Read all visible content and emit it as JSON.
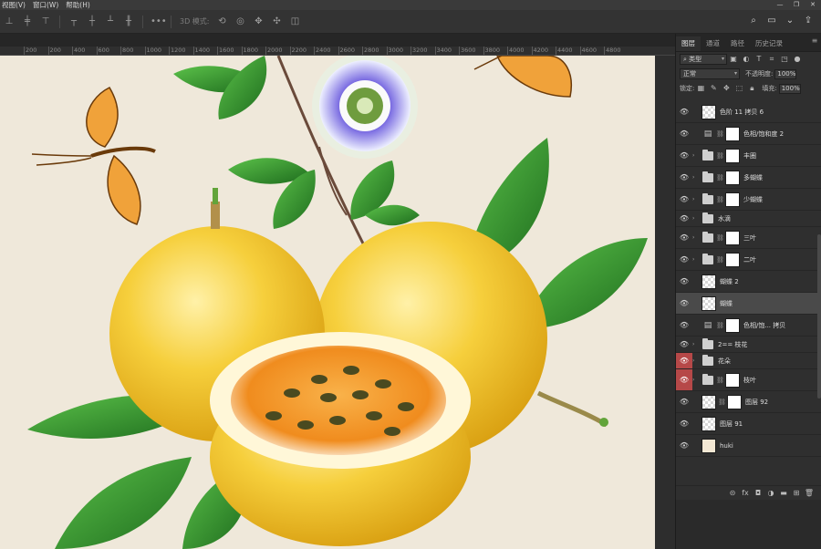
{
  "menubar": {
    "items": [
      "视图(V)",
      "窗口(W)",
      "帮助(H)"
    ],
    "window_controls": [
      "—",
      "❐",
      "✕"
    ]
  },
  "options_bar": {
    "more_label": "•••",
    "mode_label": "3D 模式:"
  },
  "ruler": {
    "ticks": [
      "200",
      "200",
      "400",
      "600",
      "800",
      "1000",
      "1200",
      "1400",
      "1600",
      "1800",
      "2000",
      "2200",
      "2400",
      "2600",
      "2800",
      "3000",
      "3200",
      "3400",
      "3600",
      "3800",
      "4000",
      "4200",
      "4400",
      "4600",
      "4800"
    ]
  },
  "panel": {
    "tabs": [
      "图层",
      "通道",
      "路径",
      "历史记录"
    ],
    "filter_kind": "类型",
    "blend_mode": "正常",
    "opacity_label": "不透明度:",
    "opacity_value": "100%",
    "lock_label": "锁定:",
    "fill_label": "填充:",
    "fill_value": "100%"
  },
  "layers": [
    {
      "name": "色阶 11 拷贝 6",
      "type": "pixel",
      "eye": "normal",
      "selected": false
    },
    {
      "name": "色相/饱和度 2",
      "type": "adjustment",
      "eye": "normal",
      "selected": false
    },
    {
      "name": "丰圈",
      "type": "group",
      "eye": "normal",
      "selected": false
    },
    {
      "name": "多蝴蝶",
      "type": "group",
      "eye": "normal",
      "selected": false
    },
    {
      "name": "少蝴蝶",
      "type": "group",
      "eye": "normal",
      "selected": false
    },
    {
      "name": "水滴",
      "type": "group-short",
      "eye": "normal",
      "selected": false
    },
    {
      "name": "三叶",
      "type": "group",
      "eye": "normal",
      "selected": false
    },
    {
      "name": "二叶",
      "type": "group",
      "eye": "normal",
      "selected": false
    },
    {
      "name": "蝴蝶 2",
      "type": "pixel",
      "eye": "normal",
      "selected": false
    },
    {
      "name": "蝴蝶",
      "type": "pixel",
      "eye": "normal",
      "selected": true
    },
    {
      "name": "色相/饱... 拷贝",
      "type": "adjustment",
      "eye": "normal",
      "selected": false
    },
    {
      "name": "2== 枝花",
      "type": "group-short",
      "eye": "normal",
      "selected": false
    },
    {
      "name": "花朵",
      "type": "group-short",
      "eye": "red",
      "selected": false
    },
    {
      "name": "枝叶",
      "type": "group",
      "eye": "red",
      "selected": false
    },
    {
      "name": "图层 92",
      "type": "pixel-mask",
      "eye": "normal",
      "selected": false
    },
    {
      "name": "图层 91",
      "type": "pixel",
      "eye": "normal",
      "selected": false
    },
    {
      "name": "huki",
      "type": "solid",
      "eye": "normal",
      "selected": false
    }
  ],
  "footer_icons": [
    "link-icon",
    "fx-icon",
    "mask-icon",
    "adjustment-icon",
    "folder-icon",
    "new-layer-icon",
    "trash-icon"
  ],
  "colors": {
    "canvas_bg": "#efe8da",
    "fruit_yellow": "#f2c12e",
    "leaf_green": "#2f8a2a",
    "butterfly_orange": "#f0a23a",
    "flower_purple": "#6a5ad6",
    "selected_eye_red": "#b64848"
  }
}
